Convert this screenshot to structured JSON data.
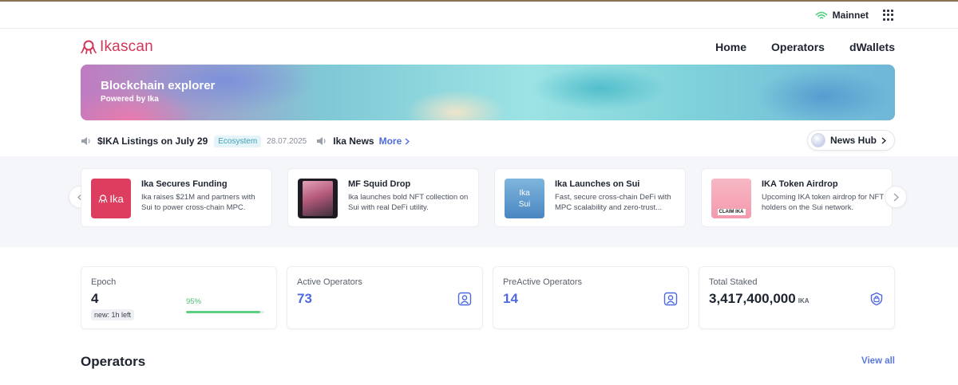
{
  "topbar": {
    "network": "Mainnet"
  },
  "header": {
    "logo_text": "Ikascan",
    "nav": [
      "Home",
      "Operators",
      "dWallets"
    ]
  },
  "banner": {
    "title": "Blockchain explorer",
    "subtitle": "Powered by Ika"
  },
  "ticker": {
    "headline": "$IKA Listings on July 29",
    "tag": "Ecosystem",
    "date": "28.07.2025",
    "news_label": "Ika News",
    "more_label": "More",
    "hub_label": "News Hub"
  },
  "news_cards": [
    {
      "title": "Ika Secures Funding",
      "desc": "Ika raises $21M and partners with Sui to power cross-chain MPC.",
      "thumb_text": "Ika"
    },
    {
      "title": "MF Squid Drop",
      "desc": "Ika launches bold NFT collection on Sui with real DeFi utility."
    },
    {
      "title": "Ika Launches on Sui",
      "desc": "Fast, secure cross-chain DeFi with MPC scalability and zero-trust...",
      "thumb_text": "Ika",
      "thumb_text2": "Sui"
    },
    {
      "title": "IKA Token Airdrop",
      "desc": "Upcoming IKA token airdrop for NFT holders on the Sui network.",
      "thumb_text": "CLAIM IKA"
    }
  ],
  "stats": {
    "epoch": {
      "label": "Epoch",
      "value": "4",
      "note": "new: 1h left",
      "progress_label": "95%",
      "progress": 0.95
    },
    "active": {
      "label": "Active Operators",
      "value": "73"
    },
    "preactive": {
      "label": "PreActive Operators",
      "value": "14"
    },
    "staked": {
      "label": "Total Staked",
      "value": "3,417,400,000",
      "unit": "IKA"
    }
  },
  "operators_section": {
    "title": "Operators",
    "view_all": "View all"
  },
  "colors": {
    "brand": "#d1375a",
    "accent": "#4f6ae0",
    "success": "#5ccf85"
  }
}
